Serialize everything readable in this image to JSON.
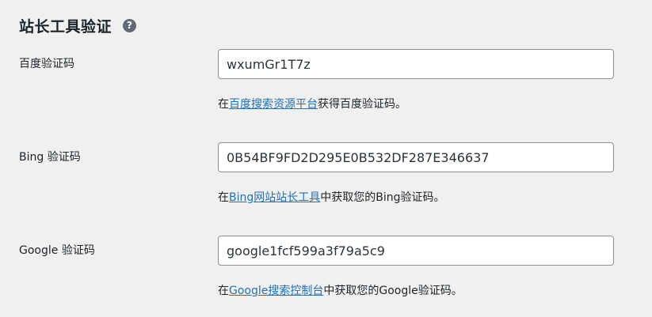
{
  "section": {
    "title": "站长工具验证",
    "help_icon_glyph": "?"
  },
  "fields": [
    {
      "label": "百度验证码",
      "value": "wxumGr1T7z",
      "desc_prefix": "在",
      "desc_link": "百度搜索资源平台",
      "desc_suffix": "获得百度验证码。"
    },
    {
      "label": "Bing 验证码",
      "value": "0B54BF9FD2D295E0B532DF287E346637",
      "desc_prefix": "在",
      "desc_link": "Bing网站站长工具",
      "desc_suffix": "中获取您的Bing验证码。"
    },
    {
      "label": "Google 验证码",
      "value": "google1fcf599a3f79a5c9",
      "desc_prefix": "在",
      "desc_link": "Google搜索控制台",
      "desc_suffix": "中获取您的Google验证码。"
    }
  ],
  "colors": {
    "background": "#f0f0f1",
    "link": "#2271b1",
    "input_border": "#8c8f94",
    "help_icon": "#646970"
  }
}
